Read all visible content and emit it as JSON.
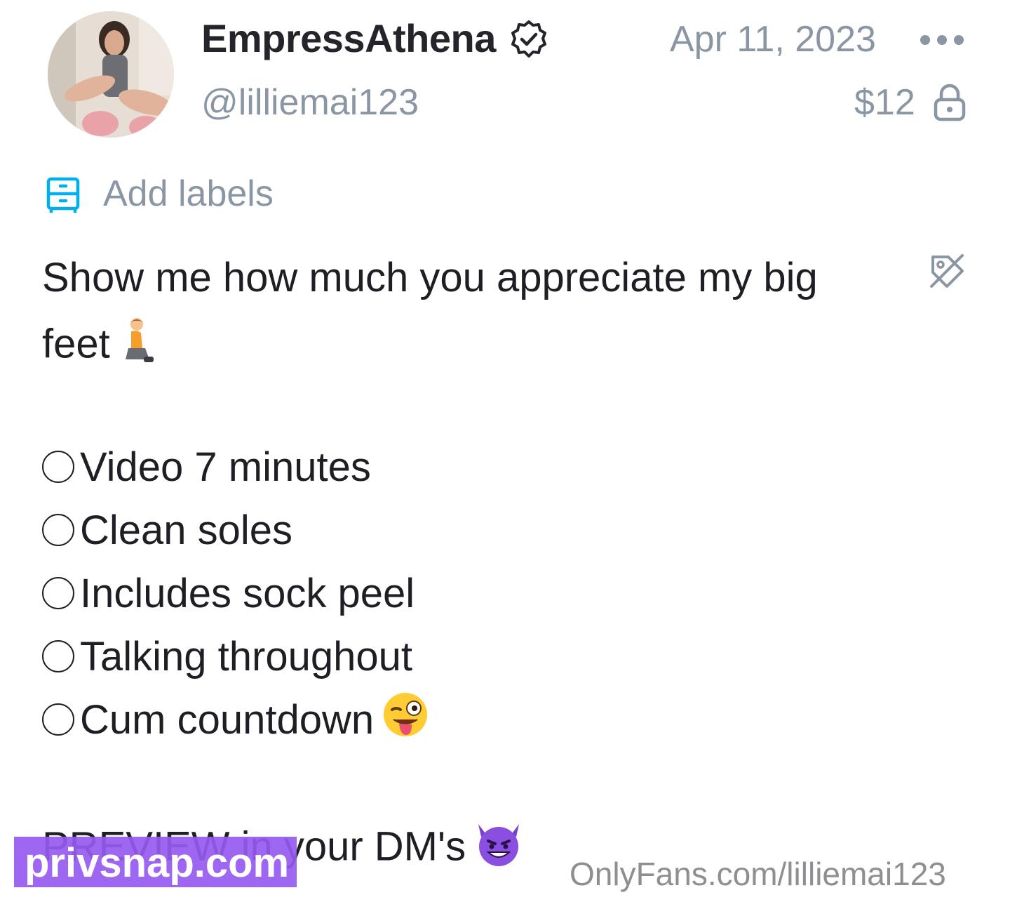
{
  "post": {
    "display_name": "EmpressAthena",
    "handle": "@lilliemai123",
    "date": "Apr 11, 2023",
    "price": "$12",
    "add_labels": "Add labels",
    "caption_line1": "Show me how much you appreciate my big",
    "caption_line2": "feet",
    "checklist": [
      "Video 7 minutes",
      "Clean soles",
      "Includes sock peel",
      "Talking throughout",
      "Cum countdown"
    ],
    "footer_line": "PREVIEW in your DM's",
    "icons": {
      "verified": "verified-badge-icon",
      "more": "more-dots-icon",
      "lock": "lock-icon",
      "labels": "labels-icon",
      "tag_off": "tag-off-icon",
      "kneeling_emoji": "person-kneeling-emoji",
      "wink_emoji": "winking-tongue-emoji",
      "devil_emoji": "smiling-devil-emoji"
    },
    "colors": {
      "muted": "#8a96a3",
      "accent": "#00aff0",
      "text": "#1e1e24"
    }
  },
  "watermark": {
    "site": "privsnap.com",
    "source_url": "OnlyFans.com/lilliemai123"
  }
}
